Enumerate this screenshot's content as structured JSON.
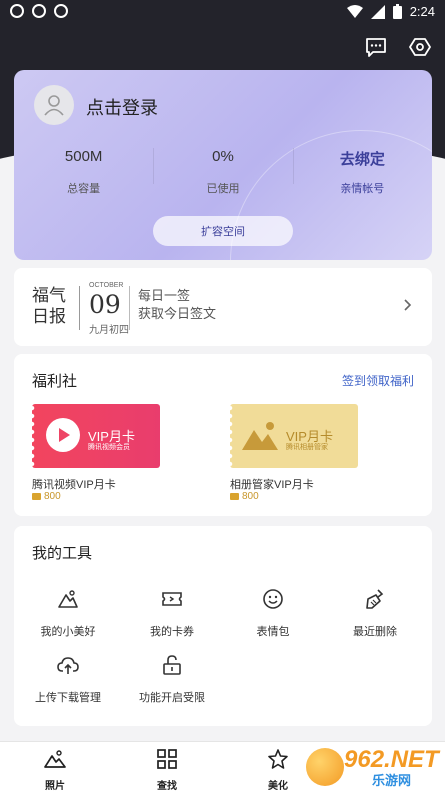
{
  "status_bar": {
    "time": "2:24"
  },
  "account": {
    "login_text": "点击登录",
    "stats": [
      {
        "value": "500M",
        "label": "总容量"
      },
      {
        "value": "0%",
        "label": "已使用"
      },
      {
        "value": "去绑定",
        "label": "亲情帐号"
      }
    ],
    "expand_button": "扩容空间"
  },
  "daily": {
    "title_line1": "福气",
    "title_line2": "日报",
    "month": "OCTOBER",
    "day": "09",
    "lunar": "九月初四",
    "sign_line1": "每日一签",
    "sign_line2": "获取今日签文"
  },
  "welfare": {
    "title": "福利社",
    "link": "签到领取福利",
    "items": [
      {
        "card_title": "VIP月卡",
        "card_sub": "腾讯视频会员",
        "name": "腾讯视频VIP月卡",
        "price": "800"
      },
      {
        "card_title": "VIP月卡",
        "card_sub": "腾讯相册管家",
        "name": "相册管家VIP月卡",
        "price": "800"
      }
    ]
  },
  "tools": {
    "title": "我的工具",
    "items": [
      {
        "label": "我的小美好",
        "icon": "mountain-icon"
      },
      {
        "label": "我的卡券",
        "icon": "ticket-icon"
      },
      {
        "label": "表情包",
        "icon": "smile-icon"
      },
      {
        "label": "最近删除",
        "icon": "broom-icon"
      },
      {
        "label": "上传下载管理",
        "icon": "cloud-upload-icon"
      },
      {
        "label": "功能开启受限",
        "icon": "unlock-icon"
      }
    ]
  },
  "bottom_nav": [
    {
      "label": "照片",
      "icon": "photo-icon"
    },
    {
      "label": "查找",
      "icon": "grid-icon"
    },
    {
      "label": "美化",
      "icon": "star-icon"
    }
  ],
  "watermark": {
    "text1": "962.NET",
    "text2": "乐游网"
  },
  "colors": {
    "accent": "#3b3f9a",
    "link": "#3f63c8",
    "vip_red": "#f2455e",
    "vip_gold": "#f1dc98"
  }
}
